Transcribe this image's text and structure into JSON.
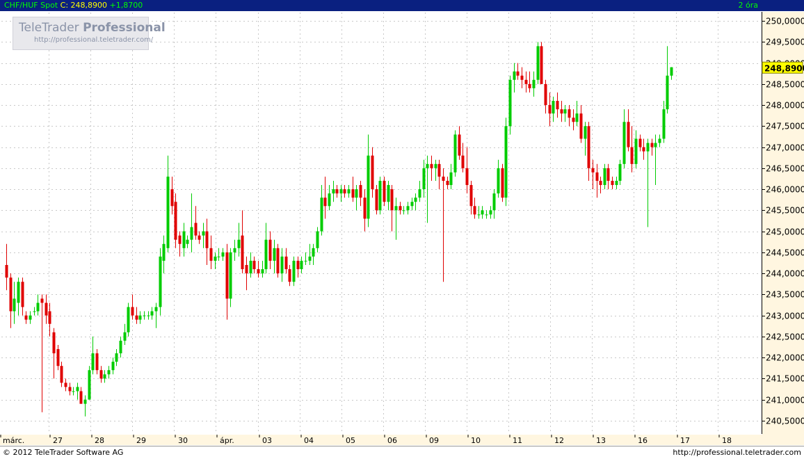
{
  "header": {
    "symbol": "CHF/HUF Spot",
    "close_label": "C: 248,8900",
    "change": "+1,8700",
    "interval": "2 óra"
  },
  "logo": {
    "brand": "TeleTrader",
    "product": "Professional",
    "url": "http://professional.teletrader.com/"
  },
  "footer": {
    "copyright": "© 2012  TeleTrader Software AG",
    "url": "http://professional.teletrader.com"
  },
  "colors": {
    "up": "#00cc00",
    "down": "#e00000",
    "grid": "#c8c8c8",
    "header_bg": "#0a2080",
    "axis_bg": "#fff6e0",
    "last_price_bg": "#ffff00"
  },
  "chart_data": {
    "type": "candlestick",
    "ylim": [
      240.2,
      250.2
    ],
    "y_ticks": [
      "240,5000",
      "241,0000",
      "241,5000",
      "242,0000",
      "242,5000",
      "243,0000",
      "243,5000",
      "244,0000",
      "244,5000",
      "245,0000",
      "245,5000",
      "246,0000",
      "246,5000",
      "247,0000",
      "247,5000",
      "248,0000",
      "248,5000",
      "249,0000",
      "249,5000",
      "250,0000"
    ],
    "x_ticks": [
      "márc.",
      "27",
      "28",
      "29",
      "30",
      "ápr.",
      "03",
      "04",
      "05",
      "06",
      "09",
      "10",
      "11",
      "12",
      "13",
      "16",
      "17",
      "18"
    ],
    "last_price": "248,8900",
    "ohlc": [
      {
        "o": 244.2,
        "h": 244.7,
        "l": 243.6,
        "c": 243.9
      },
      {
        "o": 243.9,
        "h": 244.0,
        "l": 242.7,
        "c": 243.1
      },
      {
        "o": 243.1,
        "h": 243.8,
        "l": 242.8,
        "c": 243.4
      },
      {
        "o": 243.3,
        "h": 243.9,
        "l": 243.0,
        "c": 243.8
      },
      {
        "o": 243.8,
        "h": 243.9,
        "l": 243.0,
        "c": 243.2
      },
      {
        "o": 243.0,
        "h": 243.1,
        "l": 242.8,
        "c": 242.9
      },
      {
        "o": 242.9,
        "h": 243.1,
        "l": 242.8,
        "c": 243.0
      },
      {
        "o": 243.1,
        "h": 243.2,
        "l": 243.0,
        "c": 243.1
      },
      {
        "o": 243.1,
        "h": 243.5,
        "l": 243.0,
        "c": 243.3
      },
      {
        "o": 243.4,
        "h": 243.5,
        "l": 240.7,
        "c": 243.3
      },
      {
        "o": 243.3,
        "h": 243.5,
        "l": 242.8,
        "c": 243.0
      },
      {
        "o": 243.1,
        "h": 243.3,
        "l": 242.5,
        "c": 242.8
      },
      {
        "o": 242.6,
        "h": 242.7,
        "l": 241.5,
        "c": 242.1
      },
      {
        "o": 242.2,
        "h": 242.3,
        "l": 241.7,
        "c": 241.8
      },
      {
        "o": 241.8,
        "h": 241.9,
        "l": 241.3,
        "c": 241.4
      },
      {
        "o": 241.4,
        "h": 241.5,
        "l": 241.2,
        "c": 241.3
      },
      {
        "o": 241.3,
        "h": 241.4,
        "l": 241.1,
        "c": 241.2
      },
      {
        "o": 241.2,
        "h": 241.3,
        "l": 241.1,
        "c": 241.2
      },
      {
        "o": 241.2,
        "h": 241.4,
        "l": 241.0,
        "c": 241.3
      },
      {
        "o": 241.2,
        "h": 241.3,
        "l": 240.9,
        "c": 240.9
      },
      {
        "o": 240.9,
        "h": 241.1,
        "l": 240.6,
        "c": 241.0
      },
      {
        "o": 241.0,
        "h": 241.8,
        "l": 241.0,
        "c": 241.7
      },
      {
        "o": 241.7,
        "h": 242.5,
        "l": 241.6,
        "c": 242.1
      },
      {
        "o": 242.1,
        "h": 242.2,
        "l": 241.6,
        "c": 241.7
      },
      {
        "o": 241.7,
        "h": 241.8,
        "l": 241.4,
        "c": 241.5
      },
      {
        "o": 241.5,
        "h": 241.7,
        "l": 241.4,
        "c": 241.6
      },
      {
        "o": 241.6,
        "h": 241.8,
        "l": 241.5,
        "c": 241.7
      },
      {
        "o": 241.7,
        "h": 242.0,
        "l": 241.6,
        "c": 241.9
      },
      {
        "o": 241.9,
        "h": 242.2,
        "l": 241.8,
        "c": 242.1
      },
      {
        "o": 242.1,
        "h": 242.5,
        "l": 242.0,
        "c": 242.4
      },
      {
        "o": 242.4,
        "h": 242.8,
        "l": 242.3,
        "c": 242.6
      },
      {
        "o": 242.6,
        "h": 243.3,
        "l": 242.5,
        "c": 243.2
      },
      {
        "o": 243.2,
        "h": 243.5,
        "l": 242.9,
        "c": 243.0
      },
      {
        "o": 243.0,
        "h": 243.2,
        "l": 242.8,
        "c": 242.9
      },
      {
        "o": 242.9,
        "h": 243.1,
        "l": 242.8,
        "c": 243.0
      },
      {
        "o": 243.0,
        "h": 243.1,
        "l": 242.9,
        "c": 243.0
      },
      {
        "o": 243.0,
        "h": 243.1,
        "l": 242.9,
        "c": 243.0
      },
      {
        "o": 243.0,
        "h": 243.2,
        "l": 242.9,
        "c": 243.1
      },
      {
        "o": 243.1,
        "h": 243.3,
        "l": 242.7,
        "c": 243.2
      },
      {
        "o": 243.2,
        "h": 244.6,
        "l": 243.0,
        "c": 244.4
      },
      {
        "o": 244.3,
        "h": 244.9,
        "l": 244.0,
        "c": 244.7
      },
      {
        "o": 244.6,
        "h": 246.8,
        "l": 244.5,
        "c": 246.3
      },
      {
        "o": 246.0,
        "h": 246.3,
        "l": 245.4,
        "c": 245.6
      },
      {
        "o": 245.7,
        "h": 245.9,
        "l": 244.6,
        "c": 244.8
      },
      {
        "o": 244.9,
        "h": 245.0,
        "l": 244.4,
        "c": 244.7
      },
      {
        "o": 244.6,
        "h": 245.2,
        "l": 244.4,
        "c": 245.0
      },
      {
        "o": 244.7,
        "h": 244.9,
        "l": 244.6,
        "c": 244.8
      },
      {
        "o": 244.8,
        "h": 245.9,
        "l": 244.5,
        "c": 245.1
      },
      {
        "o": 245.2,
        "h": 245.6,
        "l": 244.8,
        "c": 244.9
      },
      {
        "o": 244.9,
        "h": 245.0,
        "l": 244.7,
        "c": 244.8
      },
      {
        "o": 244.9,
        "h": 245.2,
        "l": 244.6,
        "c": 245.0
      },
      {
        "o": 245.0,
        "h": 245.3,
        "l": 244.2,
        "c": 244.6
      },
      {
        "o": 244.6,
        "h": 244.9,
        "l": 244.1,
        "c": 244.3
      },
      {
        "o": 244.3,
        "h": 244.5,
        "l": 244.1,
        "c": 244.4
      },
      {
        "o": 244.4,
        "h": 244.6,
        "l": 244.3,
        "c": 244.4
      },
      {
        "o": 244.4,
        "h": 244.6,
        "l": 244.3,
        "c": 244.5
      },
      {
        "o": 244.5,
        "h": 244.7,
        "l": 242.9,
        "c": 243.4
      },
      {
        "o": 243.4,
        "h": 244.6,
        "l": 243.2,
        "c": 244.5
      },
      {
        "o": 244.5,
        "h": 244.8,
        "l": 244.3,
        "c": 244.6
      },
      {
        "o": 244.6,
        "h": 245.2,
        "l": 244.4,
        "c": 244.8
      },
      {
        "o": 244.9,
        "h": 245.5,
        "l": 244.0,
        "c": 244.1
      },
      {
        "o": 244.2,
        "h": 244.4,
        "l": 243.6,
        "c": 244.0
      },
      {
        "o": 244.0,
        "h": 244.5,
        "l": 243.9,
        "c": 244.3
      },
      {
        "o": 244.3,
        "h": 244.4,
        "l": 244.0,
        "c": 244.1
      },
      {
        "o": 244.1,
        "h": 244.3,
        "l": 243.9,
        "c": 244.0
      },
      {
        "o": 244.0,
        "h": 244.3,
        "l": 243.9,
        "c": 244.1
      },
      {
        "o": 244.1,
        "h": 245.2,
        "l": 244.0,
        "c": 244.8
      },
      {
        "o": 244.8,
        "h": 245.0,
        "l": 244.1,
        "c": 244.3
      },
      {
        "o": 244.3,
        "h": 244.8,
        "l": 244.0,
        "c": 244.6
      },
      {
        "o": 244.6,
        "h": 244.7,
        "l": 243.9,
        "c": 244.0
      },
      {
        "o": 244.0,
        "h": 244.6,
        "l": 243.8,
        "c": 244.4
      },
      {
        "o": 244.4,
        "h": 244.6,
        "l": 244.0,
        "c": 244.1
      },
      {
        "o": 244.1,
        "h": 244.2,
        "l": 243.7,
        "c": 243.8
      },
      {
        "o": 243.8,
        "h": 244.4,
        "l": 243.7,
        "c": 244.3
      },
      {
        "o": 244.3,
        "h": 244.4,
        "l": 243.9,
        "c": 244.1
      },
      {
        "o": 244.1,
        "h": 244.4,
        "l": 244.0,
        "c": 244.3
      },
      {
        "o": 244.3,
        "h": 244.5,
        "l": 244.2,
        "c": 244.3
      },
      {
        "o": 244.3,
        "h": 244.7,
        "l": 244.2,
        "c": 244.4
      },
      {
        "o": 244.4,
        "h": 244.7,
        "l": 244.2,
        "c": 244.6
      },
      {
        "o": 244.6,
        "h": 245.1,
        "l": 244.5,
        "c": 245.0
      },
      {
        "o": 245.0,
        "h": 246.1,
        "l": 244.9,
        "c": 245.8
      },
      {
        "o": 245.8,
        "h": 246.3,
        "l": 245.3,
        "c": 245.6
      },
      {
        "o": 245.6,
        "h": 246.1,
        "l": 245.5,
        "c": 245.9
      },
      {
        "o": 245.9,
        "h": 246.2,
        "l": 245.7,
        "c": 246.0
      },
      {
        "o": 246.0,
        "h": 246.1,
        "l": 245.8,
        "c": 245.9
      },
      {
        "o": 245.9,
        "h": 246.1,
        "l": 245.7,
        "c": 246.0
      },
      {
        "o": 246.0,
        "h": 246.1,
        "l": 245.8,
        "c": 245.9
      },
      {
        "o": 245.9,
        "h": 246.1,
        "l": 245.8,
        "c": 246.0
      },
      {
        "o": 246.0,
        "h": 246.3,
        "l": 245.7,
        "c": 245.8
      },
      {
        "o": 245.8,
        "h": 246.1,
        "l": 245.5,
        "c": 246.0
      },
      {
        "o": 246.1,
        "h": 246.2,
        "l": 245.6,
        "c": 245.8
      },
      {
        "o": 245.8,
        "h": 246.0,
        "l": 245.0,
        "c": 245.3
      },
      {
        "o": 245.3,
        "h": 247.3,
        "l": 245.1,
        "c": 246.8
      },
      {
        "o": 246.8,
        "h": 247.0,
        "l": 245.8,
        "c": 246.0
      },
      {
        "o": 246.0,
        "h": 246.1,
        "l": 245.4,
        "c": 245.5
      },
      {
        "o": 245.5,
        "h": 246.3,
        "l": 245.4,
        "c": 246.2
      },
      {
        "o": 246.2,
        "h": 246.3,
        "l": 245.6,
        "c": 245.7
      },
      {
        "o": 245.7,
        "h": 246.2,
        "l": 245.5,
        "c": 246.1
      },
      {
        "o": 246.0,
        "h": 246.1,
        "l": 245.0,
        "c": 245.5
      },
      {
        "o": 245.5,
        "h": 245.8,
        "l": 244.8,
        "c": 245.6
      },
      {
        "o": 245.6,
        "h": 245.7,
        "l": 245.4,
        "c": 245.5
      },
      {
        "o": 245.5,
        "h": 245.6,
        "l": 245.4,
        "c": 245.5
      },
      {
        "o": 245.5,
        "h": 245.7,
        "l": 245.4,
        "c": 245.6
      },
      {
        "o": 245.6,
        "h": 245.8,
        "l": 245.5,
        "c": 245.7
      },
      {
        "o": 245.7,
        "h": 245.9,
        "l": 245.5,
        "c": 245.8
      },
      {
        "o": 245.8,
        "h": 246.2,
        "l": 245.7,
        "c": 246.0
      },
      {
        "o": 246.0,
        "h": 246.7,
        "l": 245.8,
        "c": 246.5
      },
      {
        "o": 246.5,
        "h": 246.8,
        "l": 245.2,
        "c": 246.6
      },
      {
        "o": 246.6,
        "h": 246.8,
        "l": 246.2,
        "c": 246.5
      },
      {
        "o": 246.5,
        "h": 246.7,
        "l": 246.2,
        "c": 246.6
      },
      {
        "o": 246.6,
        "h": 246.7,
        "l": 246.0,
        "c": 246.3
      },
      {
        "o": 246.3,
        "h": 246.5,
        "l": 243.8,
        "c": 246.2
      },
      {
        "o": 246.2,
        "h": 246.3,
        "l": 246.0,
        "c": 246.1
      },
      {
        "o": 246.1,
        "h": 246.6,
        "l": 246.0,
        "c": 246.4
      },
      {
        "o": 246.4,
        "h": 247.4,
        "l": 246.3,
        "c": 247.3
      },
      {
        "o": 247.3,
        "h": 247.5,
        "l": 246.7,
        "c": 246.8
      },
      {
        "o": 246.8,
        "h": 247.1,
        "l": 246.4,
        "c": 246.5
      },
      {
        "o": 246.5,
        "h": 247.0,
        "l": 245.9,
        "c": 246.1
      },
      {
        "o": 246.1,
        "h": 246.2,
        "l": 245.4,
        "c": 245.6
      },
      {
        "o": 245.6,
        "h": 245.8,
        "l": 245.3,
        "c": 245.4
      },
      {
        "o": 245.4,
        "h": 245.6,
        "l": 245.3,
        "c": 245.4
      },
      {
        "o": 245.4,
        "h": 245.6,
        "l": 245.3,
        "c": 245.5
      },
      {
        "o": 245.4,
        "h": 245.5,
        "l": 245.3,
        "c": 245.4
      },
      {
        "o": 245.4,
        "h": 245.6,
        "l": 245.3,
        "c": 245.5
      },
      {
        "o": 245.5,
        "h": 246.0,
        "l": 245.3,
        "c": 245.9
      },
      {
        "o": 245.9,
        "h": 246.7,
        "l": 245.8,
        "c": 246.5
      },
      {
        "o": 246.5,
        "h": 246.6,
        "l": 245.7,
        "c": 245.8
      },
      {
        "o": 245.8,
        "h": 247.7,
        "l": 245.6,
        "c": 247.5
      },
      {
        "o": 247.5,
        "h": 248.7,
        "l": 247.3,
        "c": 248.6
      },
      {
        "o": 248.6,
        "h": 249.0,
        "l": 248.3,
        "c": 248.8
      },
      {
        "o": 248.8,
        "h": 249.0,
        "l": 248.6,
        "c": 248.7
      },
      {
        "o": 248.7,
        "h": 248.9,
        "l": 248.4,
        "c": 248.6
      },
      {
        "o": 248.6,
        "h": 248.8,
        "l": 248.3,
        "c": 248.5
      },
      {
        "o": 248.5,
        "h": 248.8,
        "l": 248.3,
        "c": 248.4
      },
      {
        "o": 248.4,
        "h": 248.8,
        "l": 248.2,
        "c": 248.6
      },
      {
        "o": 248.6,
        "h": 249.5,
        "l": 248.5,
        "c": 249.4
      },
      {
        "o": 249.4,
        "h": 249.5,
        "l": 248.5,
        "c": 248.5
      },
      {
        "o": 248.5,
        "h": 248.6,
        "l": 247.8,
        "c": 248.0
      },
      {
        "o": 248.0,
        "h": 248.3,
        "l": 247.5,
        "c": 247.8
      },
      {
        "o": 247.8,
        "h": 248.2,
        "l": 247.6,
        "c": 248.1
      },
      {
        "o": 248.1,
        "h": 248.3,
        "l": 247.7,
        "c": 247.9
      },
      {
        "o": 247.9,
        "h": 248.1,
        "l": 247.6,
        "c": 247.8
      },
      {
        "o": 247.8,
        "h": 248.0,
        "l": 247.6,
        "c": 247.9
      },
      {
        "o": 247.9,
        "h": 248.0,
        "l": 247.5,
        "c": 247.7
      },
      {
        "o": 247.7,
        "h": 247.9,
        "l": 247.4,
        "c": 247.6
      },
      {
        "o": 247.6,
        "h": 248.1,
        "l": 247.5,
        "c": 247.8
      },
      {
        "o": 247.8,
        "h": 248.0,
        "l": 247.1,
        "c": 247.2
      },
      {
        "o": 247.2,
        "h": 247.6,
        "l": 246.8,
        "c": 247.5
      },
      {
        "o": 247.5,
        "h": 247.6,
        "l": 246.2,
        "c": 246.5
      },
      {
        "o": 246.5,
        "h": 246.7,
        "l": 246.0,
        "c": 246.4
      },
      {
        "o": 246.4,
        "h": 246.6,
        "l": 245.8,
        "c": 246.2
      },
      {
        "o": 246.2,
        "h": 246.3,
        "l": 245.9,
        "c": 246.1
      },
      {
        "o": 246.1,
        "h": 246.6,
        "l": 246.0,
        "c": 246.5
      },
      {
        "o": 246.5,
        "h": 246.6,
        "l": 246.0,
        "c": 246.2
      },
      {
        "o": 246.2,
        "h": 246.3,
        "l": 246.0,
        "c": 246.1
      },
      {
        "o": 246.1,
        "h": 246.3,
        "l": 246.0,
        "c": 246.2
      },
      {
        "o": 246.2,
        "h": 246.7,
        "l": 246.1,
        "c": 246.6
      },
      {
        "o": 246.6,
        "h": 247.9,
        "l": 246.5,
        "c": 247.6
      },
      {
        "o": 247.6,
        "h": 247.9,
        "l": 246.9,
        "c": 247.0
      },
      {
        "o": 247.0,
        "h": 247.5,
        "l": 246.4,
        "c": 246.6
      },
      {
        "o": 246.6,
        "h": 247.4,
        "l": 246.5,
        "c": 247.2
      },
      {
        "o": 247.2,
        "h": 247.3,
        "l": 246.9,
        "c": 247.0
      },
      {
        "o": 247.0,
        "h": 247.2,
        "l": 246.7,
        "c": 246.9
      },
      {
        "o": 246.9,
        "h": 247.2,
        "l": 245.1,
        "c": 247.1
      },
      {
        "o": 247.1,
        "h": 247.2,
        "l": 246.8,
        "c": 247.0
      },
      {
        "o": 247.0,
        "h": 247.3,
        "l": 246.1,
        "c": 247.1
      },
      {
        "o": 247.1,
        "h": 247.3,
        "l": 247.0,
        "c": 247.2
      },
      {
        "o": 247.2,
        "h": 248.1,
        "l": 247.1,
        "c": 247.9
      },
      {
        "o": 247.9,
        "h": 249.4,
        "l": 247.8,
        "c": 248.7
      },
      {
        "o": 248.7,
        "h": 248.9,
        "l": 248.6,
        "c": 248.9
      }
    ]
  }
}
